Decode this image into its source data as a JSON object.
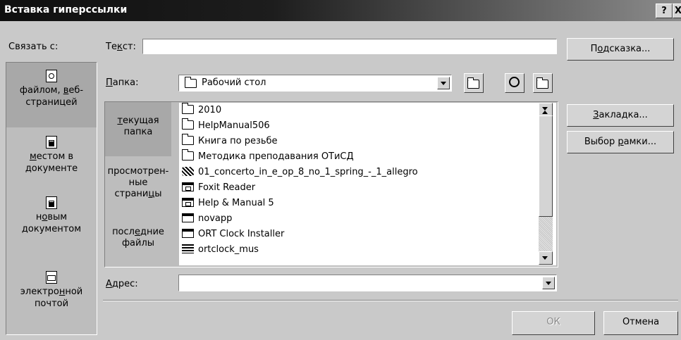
{
  "dialog": {
    "title": "Вставка гиперссылки",
    "help_button": "?",
    "close_button": "X"
  },
  "link_to": {
    "label": "Связать с:",
    "items": [
      {
        "label_pre": "файлом, ",
        "label_u": "в",
        "label_post": "еб-",
        "label_line2": "страницей",
        "icon": "web-page-icon",
        "active": true
      },
      {
        "label_u": "м",
        "label_post": "естом в",
        "label_line2": "документе",
        "icon": "place-in-document-icon",
        "active": false
      },
      {
        "label_pre": "н",
        "label_u": "о",
        "label_post": "вым",
        "label_line2": "документом",
        "icon": "new-document-icon",
        "active": false
      },
      {
        "label_pre": "электро",
        "label_u": "н",
        "label_post": "ной",
        "label_line2": "почтой",
        "icon": "email-icon",
        "active": false
      }
    ]
  },
  "text_field": {
    "label_pre": "Те",
    "label_u": "к",
    "label_post": "ст:",
    "value": ""
  },
  "tooltip_button": {
    "label_pre": "П",
    "label_u": "о",
    "label_post": "дсказка..."
  },
  "folder": {
    "label_u": "П",
    "label_post": "апка:",
    "value": "Рабочий стол",
    "icons": [
      "up-one-folder-icon",
      "search-web-icon",
      "browse-file-icon"
    ]
  },
  "tabs": [
    {
      "line1_u": "т",
      "line1_post": "екущая",
      "line2": "папка",
      "active": true
    },
    {
      "line1": "просмотрен-",
      "line2": "ные",
      "line3_pre": "страни",
      "line3_u": "ц",
      "line3_post": "ы",
      "active": false
    },
    {
      "line1_pre": "посл",
      "line1_u": "е",
      "line1_post": "дние",
      "line2": "файлы",
      "active": false
    }
  ],
  "files": [
    {
      "name": "2010",
      "icon": "folder-icon"
    },
    {
      "name": "HelpManual506",
      "icon": "folder-icon"
    },
    {
      "name": "Книга по резьбе",
      "icon": "folder-icon"
    },
    {
      "name": "Методика преподавания ОТиСД",
      "icon": "folder-icon"
    },
    {
      "name": "01_concerto_in_e_op_8_no_1_spring_-_1_allegro",
      "icon": "music-file-icon"
    },
    {
      "name": "Foxit Reader",
      "icon": "application-shortcut-icon"
    },
    {
      "name": "Help & Manual 5",
      "icon": "application-shortcut-icon"
    },
    {
      "name": "novapp",
      "icon": "window-icon"
    },
    {
      "name": "ORT Clock Installer",
      "icon": "window-icon"
    },
    {
      "name": "ortclock_mus",
      "icon": "library-icon"
    }
  ],
  "right_buttons": {
    "bookmark": {
      "label_u": "З",
      "label_post": "акладка..."
    },
    "target_frame": {
      "label_pre": "Выбор ",
      "label_u": "р",
      "label_post": "амки..."
    }
  },
  "address": {
    "label_u": "А",
    "label_post": "дрес:",
    "value": ""
  },
  "footer": {
    "ok": "ОК",
    "cancel": "Отмена"
  }
}
